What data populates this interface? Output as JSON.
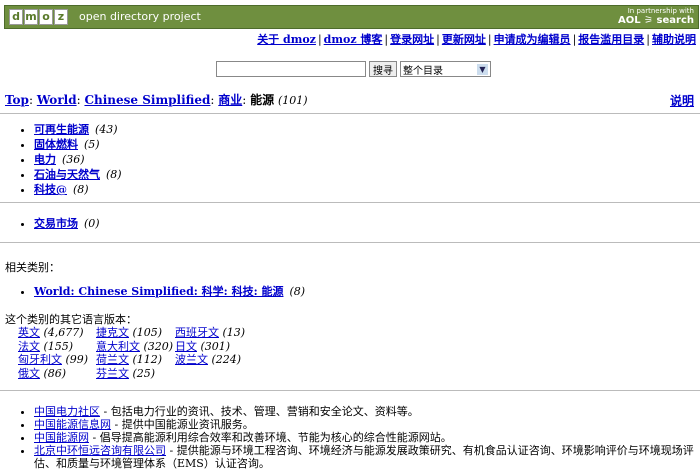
{
  "header": {
    "logo_letters": [
      "d",
      "m",
      "o",
      "z"
    ],
    "site_name": "open directory project",
    "partner_line1": "In partnership with",
    "partner_line2": "AOL ⚞ search"
  },
  "nav": {
    "items": [
      "关于 dmoz",
      "dmoz 博客",
      "登录网址",
      "更新网址",
      "申请成为编辑员",
      "报告滥用目录",
      "辅助说明"
    ]
  },
  "search": {
    "input_value": "",
    "button_label": "搜寻",
    "scope_selected": "整个目录"
  },
  "breadcrumb": {
    "top": "Top",
    "world": "World",
    "lang": "Chinese Simplified",
    "business": "商业",
    "current": "能源",
    "count": "(101)"
  },
  "help_link": "说明",
  "subcategories": [
    {
      "label": "可再生能源",
      "count": "(43)"
    },
    {
      "label": "固体燃料",
      "count": "(5)"
    },
    {
      "label": "电力",
      "count": "(36)"
    },
    {
      "label": "石油与天然气",
      "count": "(8)"
    },
    {
      "label": "科技@",
      "count": "(8)"
    }
  ],
  "subcategories2": [
    {
      "label": "交易市场",
      "count": "(0)"
    }
  ],
  "related": {
    "title": "相关类别：",
    "items": [
      {
        "label": "World: Chinese Simplified: 科学: 科技: 能源",
        "count": "(8)"
      }
    ]
  },
  "other_languages": {
    "title": "这个类别的其它语言版本：",
    "rows": [
      [
        {
          "name": "英文",
          "count": "(4,677)"
        },
        {
          "name": "捷克文",
          "count": "(105)"
        },
        {
          "name": "西班牙文",
          "count": "(13)"
        }
      ],
      [
        {
          "name": "法文",
          "count": "(155)"
        },
        {
          "name": "意大利文",
          "count": "(320)"
        },
        {
          "name": "日文",
          "count": "(301)"
        }
      ],
      [
        {
          "name": "匈牙利文",
          "count": "(99)"
        },
        {
          "name": "荷兰文",
          "count": "(112)"
        },
        {
          "name": "波兰文",
          "count": "(224)"
        }
      ],
      [
        {
          "name": "俄文",
          "count": "(86)"
        },
        {
          "name": "芬兰文",
          "count": "(25)"
        }
      ]
    ]
  },
  "sites": [
    {
      "title": "中国电力社区",
      "desc": " - 包括电力行业的资讯、技术、管理、营销和安全论文、资料等。"
    },
    {
      "title": "中国能源信息网",
      "desc": " - 提供中国能源业资讯服务。"
    },
    {
      "title": "中国能源网",
      "desc": " - 倡导提高能源利用综合效率和改善环境、节能为核心的综合性能源网站。"
    },
    {
      "title": "北京中环恒远咨询有限公司",
      "desc": " - 提供能源与环境工程咨询、环境经济与能源发展政策研究、有机食品认证咨询、环境影响评价与环境现场评估、和质量与环境管理体系（EMS）认证咨询。"
    }
  ]
}
